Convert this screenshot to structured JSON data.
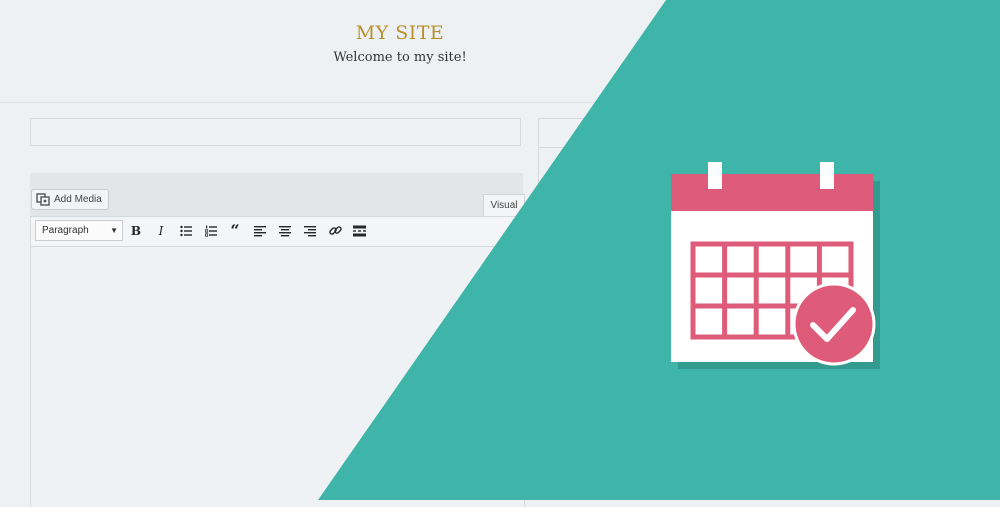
{
  "header": {
    "site_title": "MY SITE",
    "site_description": "Welcome to my site!"
  },
  "editor": {
    "add_media_label": "Add Media",
    "visual_tab_label": "Visual",
    "format_select_value": "Paragraph"
  },
  "toolbar_buttons": [
    {
      "name": "bold",
      "icon": "bold-icon"
    },
    {
      "name": "italic",
      "icon": "italic-icon"
    },
    {
      "name": "bulleted-list",
      "icon": "bulleted-list-icon"
    },
    {
      "name": "numbered-list",
      "icon": "numbered-list-icon"
    },
    {
      "name": "blockquote",
      "icon": "blockquote-icon"
    },
    {
      "name": "align-left",
      "icon": "align-left-icon"
    },
    {
      "name": "align-center",
      "icon": "align-center-icon"
    },
    {
      "name": "align-right",
      "icon": "align-right-icon"
    },
    {
      "name": "insert-link",
      "icon": "link-icon"
    },
    {
      "name": "read-more",
      "icon": "read-more-icon"
    }
  ],
  "colors": {
    "teal": "#3fb5aa",
    "calendar_pink": "#de5b7a",
    "site_title_gold": "#b8912e",
    "background": "#edf1f4"
  },
  "illustration": {
    "icon": "calendar-check-icon"
  }
}
